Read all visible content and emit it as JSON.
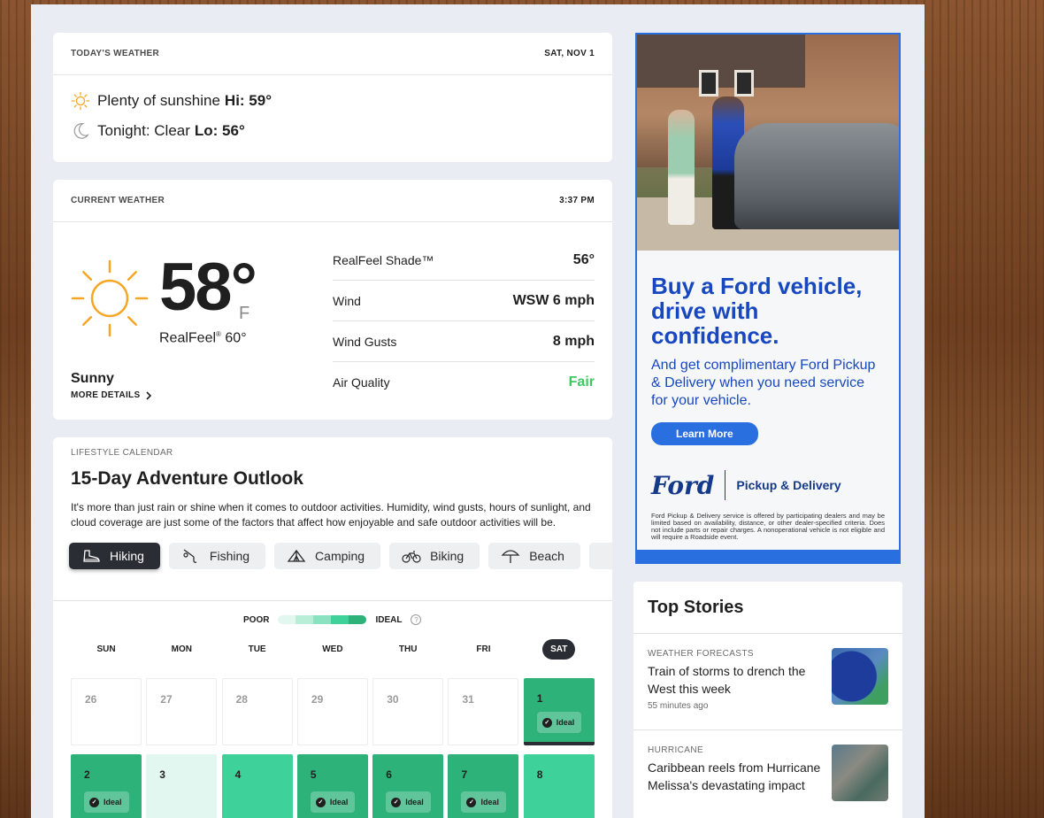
{
  "today": {
    "label": "TODAY'S WEATHER",
    "date": "SAT, NOV 1",
    "day_phrase": "Plenty of sunshine",
    "day_hi": "Hi: 59°",
    "night_phrase": "Tonight: Clear",
    "night_lo": "Lo: 56°",
    "day_icon": "sun-icon",
    "night_icon": "moon-icon"
  },
  "current": {
    "label": "CURRENT WEATHER",
    "time": "3:37 PM",
    "temp": "58°",
    "unit": "F",
    "realfeel_label": "RealFeel",
    "realfeel_mark": "®",
    "realfeel_value": "60°",
    "phrase": "Sunny",
    "more_details": "MORE DETAILS",
    "details": [
      {
        "label": "RealFeel Shade™",
        "value": "56°"
      },
      {
        "label": "Wind",
        "value": "WSW 6 mph"
      },
      {
        "label": "Wind Gusts",
        "value": "8 mph"
      },
      {
        "label": "Air Quality",
        "value": "Fair"
      }
    ],
    "air_quality_color": "#3cc95f"
  },
  "lifestyle": {
    "category": "LIFESTYLE CALENDAR",
    "title": "15-Day Adventure Outlook",
    "description": "It's more than just rain or shine when it comes to outdoor activities. Humidity, wind gusts, hours of sunlight, and cloud coverage are just some of the factors that affect how enjoyable and safe outdoor activities will be.",
    "tabs": [
      {
        "label": "Hiking",
        "icon": "hiking-boot-icon"
      },
      {
        "label": "Fishing",
        "icon": "fishing-icon"
      },
      {
        "label": "Camping",
        "icon": "tent-icon"
      },
      {
        "label": "Biking",
        "icon": "bicycle-icon"
      },
      {
        "label": "Beach",
        "icon": "umbrella-icon"
      }
    ],
    "legend_poor": "POOR",
    "legend_ideal": "IDEAL",
    "legend_help": "?",
    "legend_colors": [
      "#e1f7ef",
      "#b8eed8",
      "#8ae3c0",
      "#3fd19a",
      "#2db27a"
    ],
    "days_of_week": [
      "SUN",
      "MON",
      "TUE",
      "WED",
      "THU",
      "FRI",
      "SAT"
    ],
    "ideal_label": "Ideal",
    "week1": [
      "26",
      "27",
      "28",
      "29",
      "30",
      "31",
      "1"
    ],
    "week2": [
      "2",
      "3",
      "4",
      "5",
      "6",
      "7",
      "8"
    ]
  },
  "ad": {
    "headline": "Buy a Ford vehicle, drive with confidence.",
    "sub": "And get complimentary Ford Pickup & Delivery when you need service for your vehicle.",
    "button": "Learn More",
    "brand": "Ford",
    "brand_service": "Pickup & Delivery",
    "fine_print": "Ford Pickup & Delivery service is offered by participating dealers and may be limited based on availability, distance, or other dealer-specified criteria. Does not include parts or repair charges. A nonoperational vehicle is not eligible and will require a Roadside event."
  },
  "top_stories": {
    "title": "Top Stories",
    "items": [
      {
        "category": "WEATHER FORECASTS",
        "title": "Train of storms to drench the West this week",
        "ago": "55 minutes ago"
      },
      {
        "category": "HURRICANE",
        "title": "Caribbean reels from Hurricane Melissa's devastating impact",
        "ago": ""
      }
    ]
  }
}
